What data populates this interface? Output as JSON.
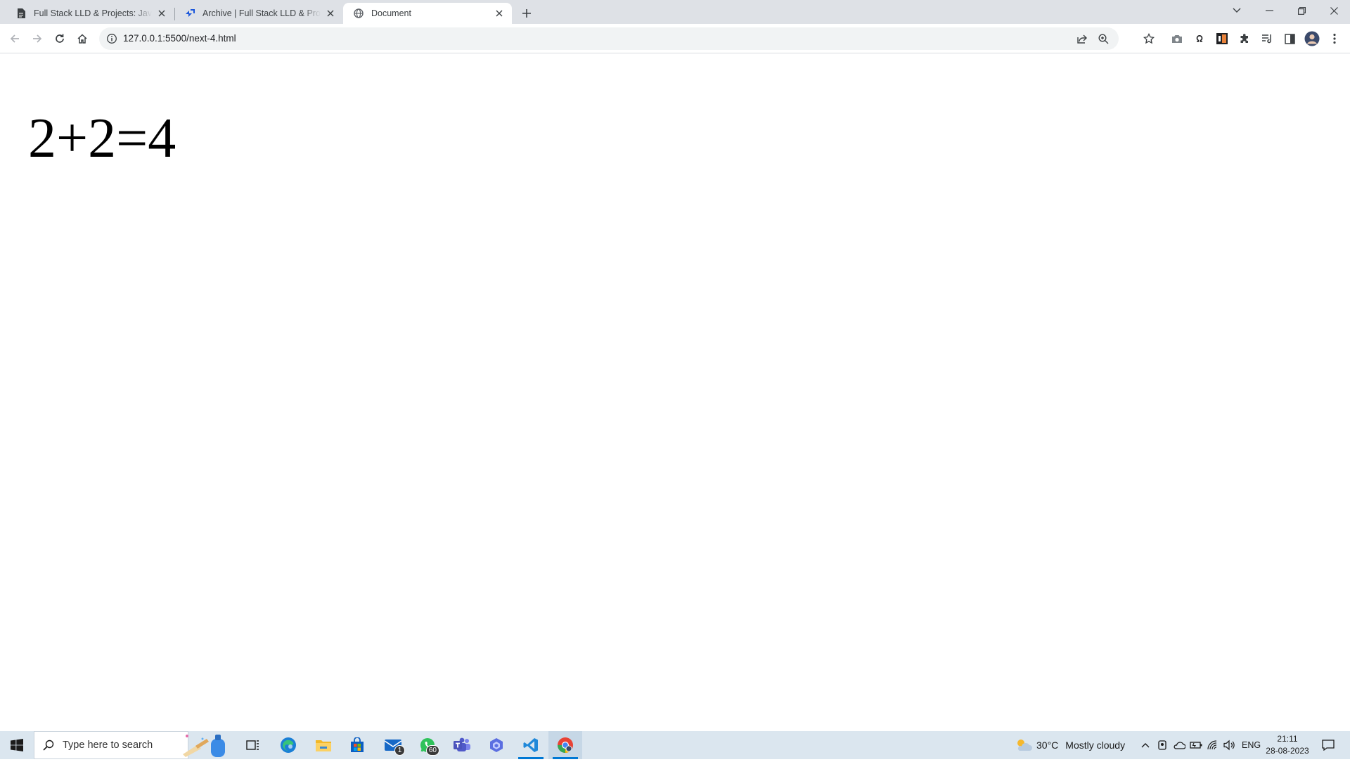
{
  "browser": {
    "tabs": [
      {
        "title": "Full Stack LLD & Projects: JavaScript",
        "favicon": "document-icon"
      },
      {
        "title": "Archive | Full Stack LLD & Projects",
        "favicon": "scaler-icon"
      },
      {
        "title": "Document",
        "favicon": "globe-icon",
        "active": true
      }
    ],
    "url": "127.0.0.1:5500/next-4.html"
  },
  "page": {
    "heading": "2+2=4"
  },
  "taskbar": {
    "search_placeholder": "Type here to search",
    "mail_badge": "1",
    "whatsapp_badge": "60",
    "weather_temp": "30°C",
    "weather_text": "Mostly cloudy",
    "language": "ENG",
    "time": "21:11",
    "date": "28-08-2023"
  },
  "colors": {
    "tabbar": "#dee1e6",
    "omnibox": "#f1f3f4",
    "taskbar": "#dbe6ef",
    "accent": "#0078d4"
  }
}
